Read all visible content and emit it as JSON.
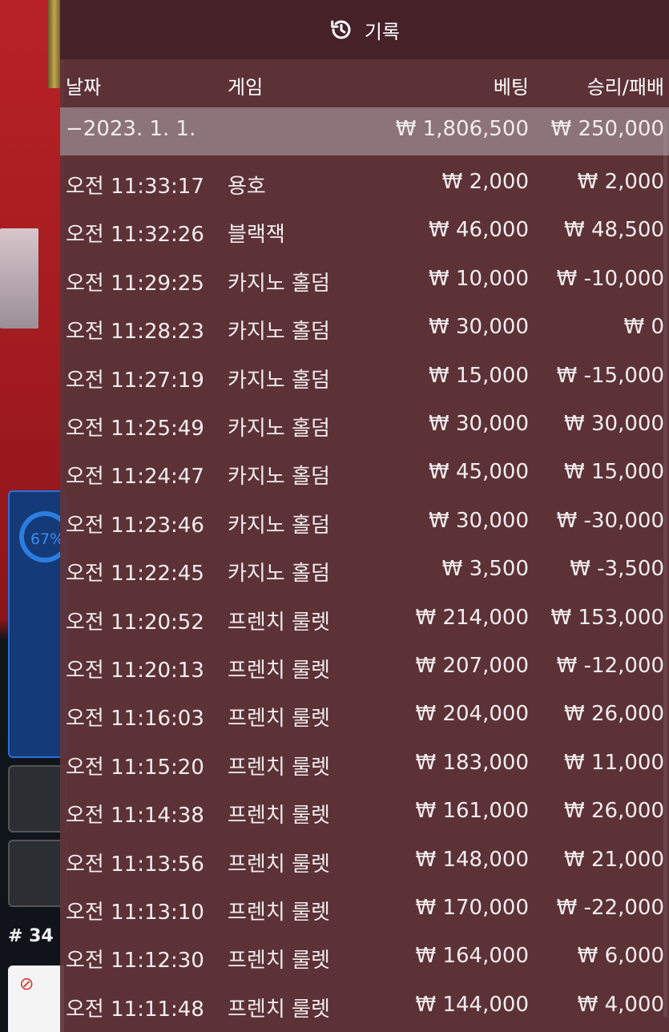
{
  "background": {
    "stat_percent": "67%",
    "round_number": "# 34"
  },
  "history": {
    "title": "기록",
    "columns": {
      "date": "날짜",
      "game": "게임",
      "bet": "베팅",
      "result": "승리/패배"
    },
    "summary": {
      "date": "−2023. 1. 1.",
      "bet": "₩ 1,806,500",
      "result": "₩ 250,000"
    },
    "rows": [
      {
        "time": "오전 11:33:17",
        "game": "용호",
        "bet": "₩ 2,000",
        "result": "₩ 2,000"
      },
      {
        "time": "오전 11:32:26",
        "game": "블랙잭",
        "bet": "₩ 46,000",
        "result": "₩ 48,500"
      },
      {
        "time": "오전 11:29:25",
        "game": "카지노 홀덤",
        "bet": "₩ 10,000",
        "result": "₩ -10,000"
      },
      {
        "time": "오전 11:28:23",
        "game": "카지노 홀덤",
        "bet": "₩ 30,000",
        "result": "₩ 0"
      },
      {
        "time": "오전 11:27:19",
        "game": "카지노 홀덤",
        "bet": "₩ 15,000",
        "result": "₩ -15,000"
      },
      {
        "time": "오전 11:25:49",
        "game": "카지노 홀덤",
        "bet": "₩ 30,000",
        "result": "₩ 30,000"
      },
      {
        "time": "오전 11:24:47",
        "game": "카지노 홀덤",
        "bet": "₩ 45,000",
        "result": "₩ 15,000"
      },
      {
        "time": "오전 11:23:46",
        "game": "카지노 홀덤",
        "bet": "₩ 30,000",
        "result": "₩ -30,000"
      },
      {
        "time": "오전 11:22:45",
        "game": "카지노 홀덤",
        "bet": "₩ 3,500",
        "result": "₩ -3,500"
      },
      {
        "time": "오전 11:20:52",
        "game": "프렌치 룰렛",
        "bet": "₩ 214,000",
        "result": "₩ 153,000"
      },
      {
        "time": "오전 11:20:13",
        "game": "프렌치 룰렛",
        "bet": "₩ 207,000",
        "result": "₩ -12,000"
      },
      {
        "time": "오전 11:16:03",
        "game": "프렌치 룰렛",
        "bet": "₩ 204,000",
        "result": "₩ 26,000"
      },
      {
        "time": "오전 11:15:20",
        "game": "프렌치 룰렛",
        "bet": "₩ 183,000",
        "result": "₩ 11,000"
      },
      {
        "time": "오전 11:14:38",
        "game": "프렌치 룰렛",
        "bet": "₩ 161,000",
        "result": "₩ 26,000"
      },
      {
        "time": "오전 11:13:56",
        "game": "프렌치 룰렛",
        "bet": "₩ 148,000",
        "result": "₩ 21,000"
      },
      {
        "time": "오전 11:13:10",
        "game": "프렌치 룰렛",
        "bet": "₩ 170,000",
        "result": "₩ -22,000"
      },
      {
        "time": "오전 11:12:30",
        "game": "프렌치 룰렛",
        "bet": "₩ 164,000",
        "result": "₩ 6,000"
      },
      {
        "time": "오전 11:11:48",
        "game": "프렌치 룰렛",
        "bet": "₩ 144,000",
        "result": "₩ 4,000"
      }
    ]
  }
}
